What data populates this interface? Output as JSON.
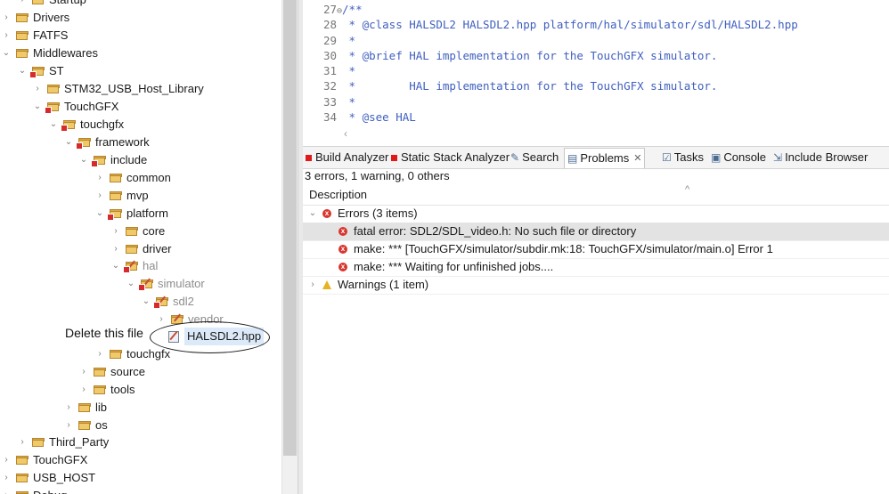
{
  "tree": {
    "items": [
      {
        "label": "Startup"
      },
      {
        "label": "Drivers"
      },
      {
        "label": "FATFS"
      },
      {
        "label": "Middlewares"
      },
      {
        "label": "ST"
      },
      {
        "label": "STM32_USB_Host_Library"
      },
      {
        "label": "TouchGFX"
      },
      {
        "label": "touchgfx"
      },
      {
        "label": "framework"
      },
      {
        "label": "include"
      },
      {
        "label": "common"
      },
      {
        "label": "mvp"
      },
      {
        "label": "platform"
      },
      {
        "label": "core"
      },
      {
        "label": "driver"
      },
      {
        "label": "hal"
      },
      {
        "label": "simulator"
      },
      {
        "label": "sdl2"
      },
      {
        "label": "vendor"
      },
      {
        "label": "HALSDL2.hpp"
      },
      {
        "label": "touchgfx"
      },
      {
        "label": "source"
      },
      {
        "label": "tools"
      },
      {
        "label": "lib"
      },
      {
        "label": "os"
      },
      {
        "label": "Third_Party"
      },
      {
        "label": "TouchGFX"
      },
      {
        "label": "USB_HOST"
      },
      {
        "label": "Debug"
      }
    ]
  },
  "annotation": {
    "text": "Delete this file"
  },
  "editor": {
    "lines": [
      {
        "num": "27",
        "text": "/**"
      },
      {
        "num": "28",
        "text": " * @class HALSDL2 HALSDL2.hpp platform/hal/simulator/sdl/HALSDL2.hpp"
      },
      {
        "num": "29",
        "text": " *"
      },
      {
        "num": "30",
        "text": " * @brief HAL implementation for the TouchGFX simulator."
      },
      {
        "num": "31",
        "text": " *"
      },
      {
        "num": "32",
        "text": " *        HAL implementation for the TouchGFX simulator."
      },
      {
        "num": "33",
        "text": " *"
      },
      {
        "num": "34",
        "text": " * @see HAL"
      }
    ]
  },
  "tabs": [
    {
      "label": "Build Analyzer"
    },
    {
      "label": "Static Stack Analyzer"
    },
    {
      "label": "Search"
    },
    {
      "label": "Problems"
    },
    {
      "label": "Tasks"
    },
    {
      "label": "Console"
    },
    {
      "label": "Include Browser"
    }
  ],
  "problems": {
    "summary": "3 errors, 1 warning, 0 others",
    "column": "Description",
    "errors_group": "Errors (3 items)",
    "errors": [
      "fatal error: SDL2/SDL_video.h: No such file or directory",
      "make: *** [TouchGFX/simulator/subdir.mk:18: TouchGFX/simulator/main.o] Error 1",
      "make: *** Waiting for unfinished jobs...."
    ],
    "warnings_group": "Warnings (1 item)"
  },
  "colors": {
    "error": "#d8352f",
    "warning": "#e6b422",
    "comment": "#3f5fbf",
    "selection": "#e3e3e3"
  }
}
